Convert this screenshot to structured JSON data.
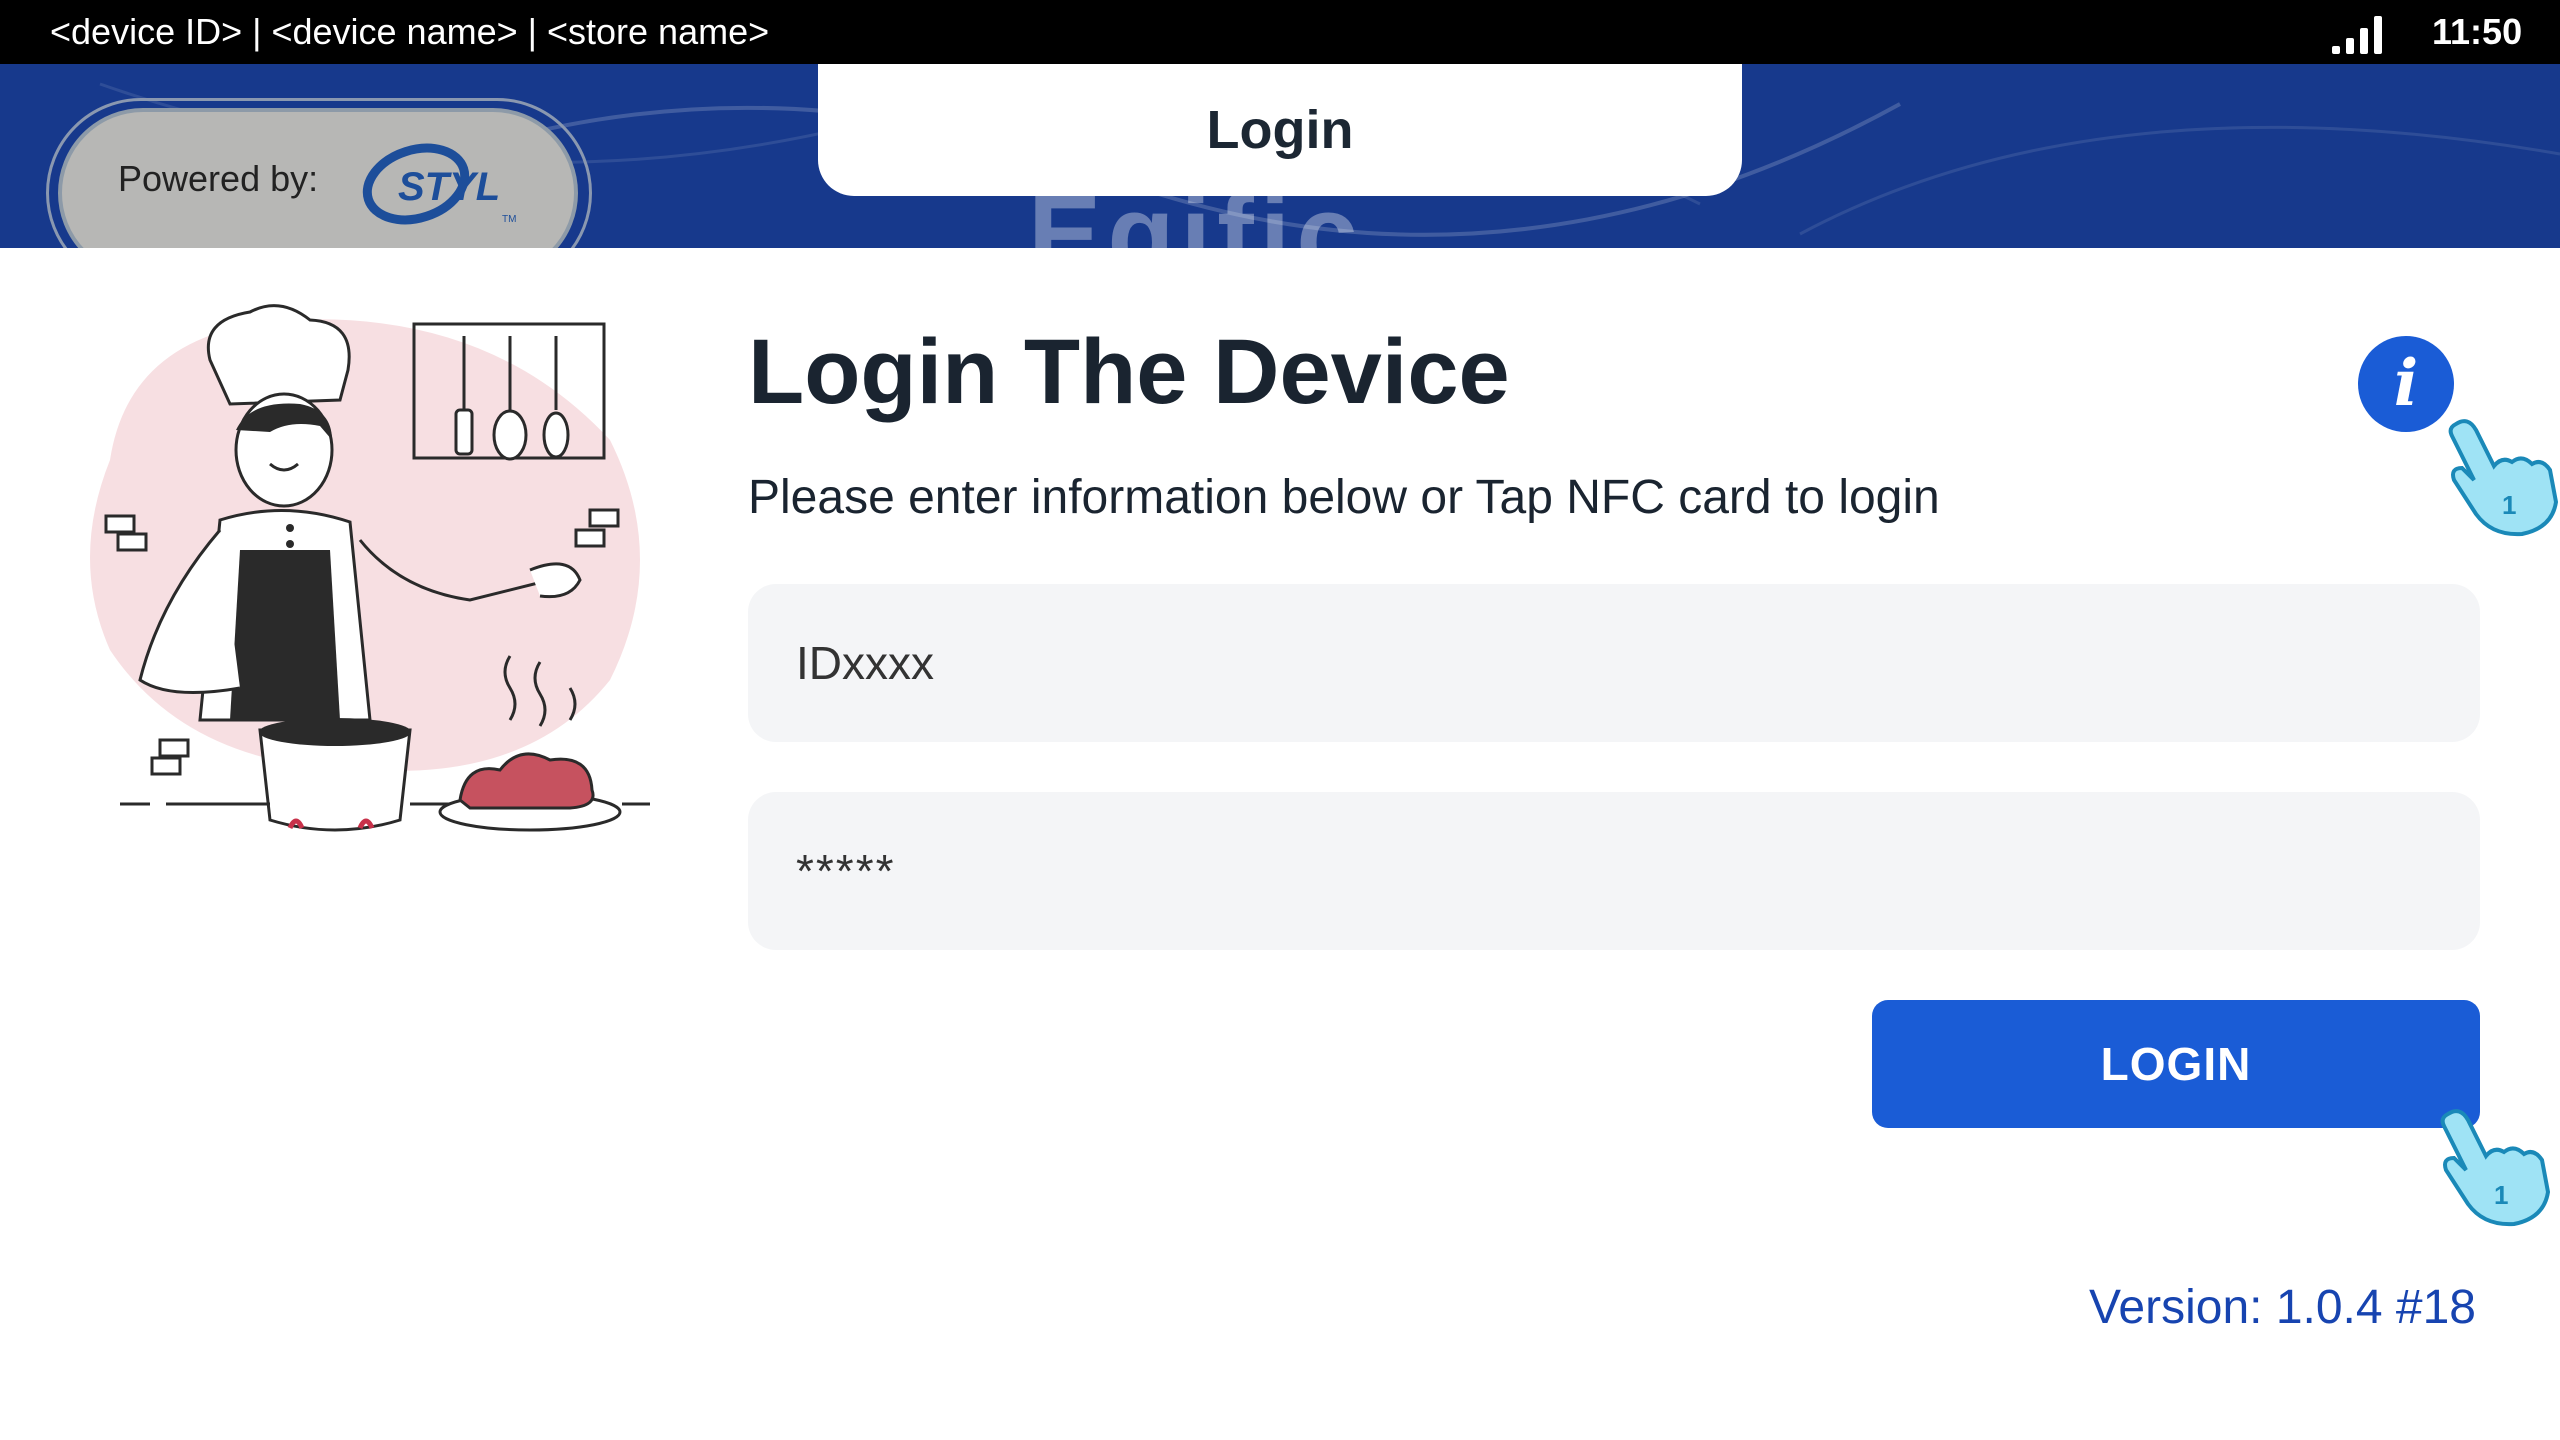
{
  "status_bar": {
    "device_info": "<device ID> | <device name> | <store name>",
    "time": "11:50",
    "signal_icon": "signal-bars-icon"
  },
  "header": {
    "powered_by_label": "Powered by:",
    "brand_logo_text": "STYL",
    "title": "Login",
    "background_word": "Eqific"
  },
  "main": {
    "heading": "Login The Device",
    "subheading": "Please enter information below or Tap NFC card to login",
    "info_icon": "info-icon",
    "username_value": "IDxxxx",
    "password_value": "*****",
    "login_label": "LOGIN",
    "version": "Version: 1.0.4 #18"
  },
  "colors": {
    "primary": "#1a5cd6",
    "banner": "#17398c",
    "text_dark": "#1a2430",
    "version_text": "#1744b0"
  }
}
